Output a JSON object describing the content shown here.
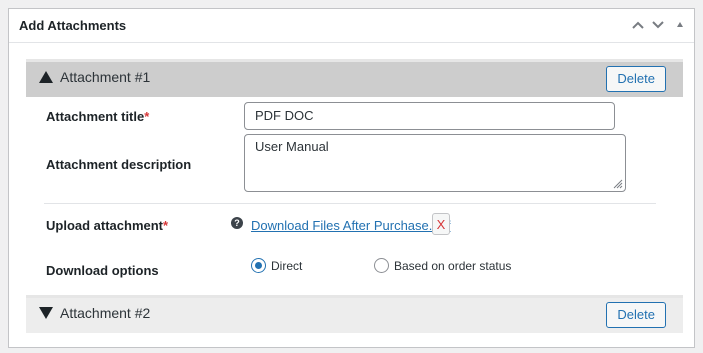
{
  "panel": {
    "title": "Add Attachments"
  },
  "attachments": [
    {
      "heading": "Attachment #1",
      "delete_label": "Delete",
      "title_label": "Attachment title",
      "title_value": "PDF DOC",
      "description_label": "Attachment description",
      "description_value": "User Manual",
      "upload_label": "Upload attachment",
      "help_glyph": "?",
      "file_name": "Download Files After Purchase.pdf",
      "remove_label": "X",
      "download_label": "Download options",
      "options": [
        "Direct",
        "Based on order status"
      ],
      "selected_option": "Direct"
    },
    {
      "heading": "Attachment #2",
      "delete_label": "Delete"
    }
  ],
  "required_mark": "*",
  "colors": {
    "accent": "#2271b1",
    "required": "#d63638",
    "header_expanded": "#cdcdcd",
    "header_collapsed": "#ededed"
  },
  "icons": {
    "move_up": "chevron-up-icon",
    "move_down": "chevron-down-icon",
    "toggle_panel": "triangle-up-icon",
    "expanded": "triangle-up-icon",
    "collapsed": "triangle-down-icon",
    "help": "question-circle-icon",
    "resize": "resize-grip-icon"
  }
}
